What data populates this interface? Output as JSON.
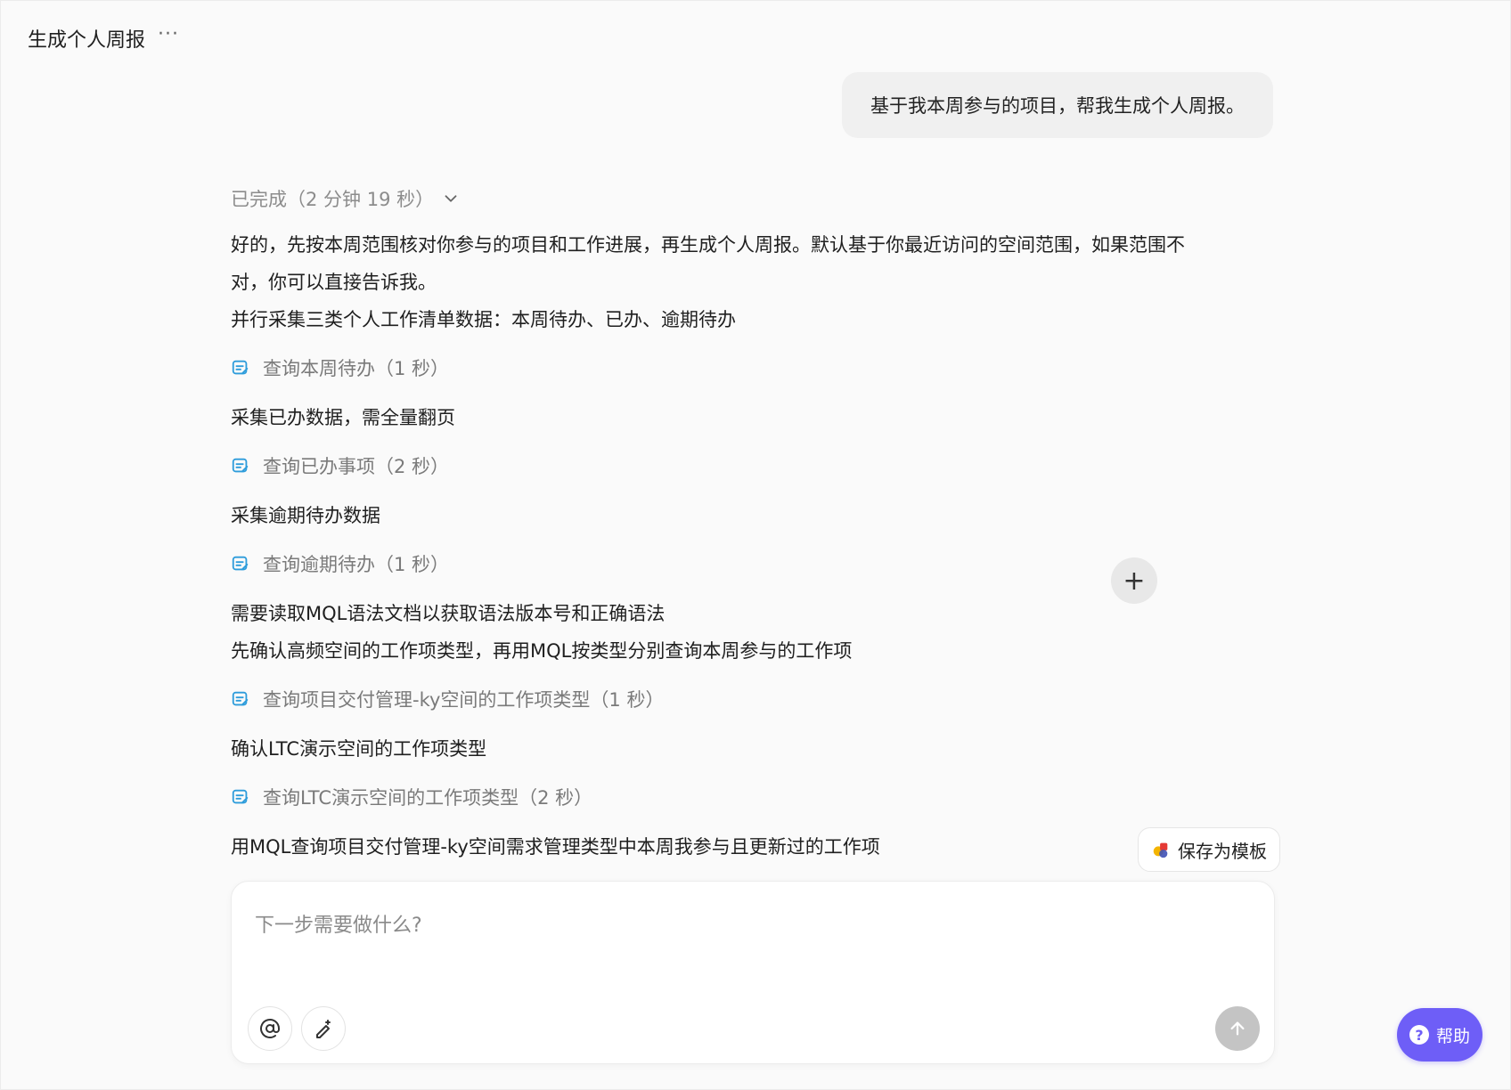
{
  "header": {
    "title": "生成个人周报",
    "more_icon": "···"
  },
  "user_message": "基于我本周参与的项目，帮我生成个人周报。",
  "status": {
    "label": "已完成（2 分钟 19 秒）"
  },
  "intro_lines": [
    "好的，先按本周范围核对你参与的项目和工作进展，再生成个人周报。默认基于你最近访问的空间范围，如果范围不\n对，你可以直接告诉我。",
    "并行采集三类个人工作清单数据：本周待办、已办、逾期待办"
  ],
  "tool_1": "查询本周待办（1 秒）",
  "step_2": "采集已办数据，需全量翻页",
  "tool_2": "查询已办事项（2 秒）",
  "step_3": "采集逾期待办数据",
  "tool_3": "查询逾期待办（1 秒）",
  "step_4_lines": [
    "需要读取MQL语法文档以获取语法版本号和正确语法",
    "先确认高频空间的工作项类型，再用MQL按类型分别查询本周参与的工作项"
  ],
  "tool_4": "查询项目交付管理-ky空间的工作项类型（1 秒）",
  "step_5": "确认LTC演示空间的工作项类型",
  "tool_5": "查询LTC演示空间的工作项类型（2 秒）",
  "step_6_partial": "用MQL查询项目交付管理-ky空间需求管理类型中本周我参与且更新过的工作项",
  "buttons": {
    "plus": "+",
    "save_template": "保存为模板",
    "help": "帮助"
  },
  "composer": {
    "placeholder": "下一步需要做什么?"
  },
  "icons": {
    "status_toggle": "chevron-down-icon",
    "tool": "tool-card-icon",
    "mention": "at-sign-icon",
    "magic": "magic-wand-icon",
    "send": "arrow-up-icon",
    "help": "question-icon"
  },
  "colors": {
    "accent": "#6e5ef7",
    "tool_icon": "#2d9cdb",
    "send_disabled": "#c4c4c4"
  }
}
